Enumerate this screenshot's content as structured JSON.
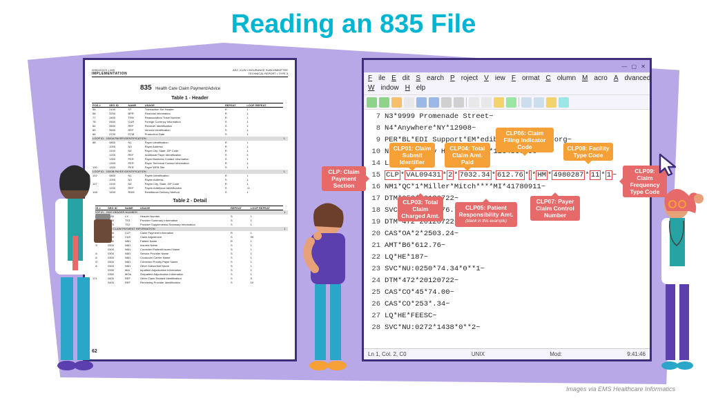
{
  "title": "Reading an 835 File",
  "credit": "Images via EMS Healthcare Informatics",
  "doc_left": {
    "header_small": "005010X221 • 835",
    "header_right1": "ASC X12N • INSURANCE SUBCOMMITTEE",
    "header_right2": "TECHNICAL REPORT • TYPE 3",
    "impl": "IMPLEMENTATION",
    "code": "835",
    "subtitle": "Health Care Claim Payment/Advice",
    "table1_label": "Table 1 - Header",
    "table2_label": "Table 2 - Detail",
    "cols": [
      "POS #",
      "SEG ID",
      "NAME",
      "USAGE",
      "REPEAT",
      "LOOP REPEAT"
    ],
    "t1_rows": [
      [
        "58",
        "0100",
        "ST",
        "Transaction Set Header",
        "R",
        "1",
        ""
      ],
      [
        "58",
        "0200",
        "BPR",
        "Financial Information",
        "R",
        "1",
        ""
      ],
      [
        "77",
        "0400",
        "TRN",
        "Reassociation Trace Number",
        "R",
        "1",
        ""
      ],
      [
        "78",
        "0500",
        "CUR",
        "Foreign Currency Information",
        "S",
        "1",
        ""
      ],
      [
        "84",
        "0600",
        "REF",
        "Receiver Identification",
        "S",
        "1",
        ""
      ],
      [
        "85",
        "0600",
        "REF",
        "Version Identification",
        "S",
        "1",
        ""
      ],
      [
        "86",
        "0700",
        "DTM",
        "Production Date",
        "S",
        "1",
        ""
      ]
    ],
    "t1_loop1": "LOOP ID - 1000A PAYER IDENTIFICATION",
    "t1_rows_b": [
      [
        "88",
        "0800",
        "N1",
        "Payer Identification",
        "R",
        "1",
        ""
      ],
      [
        "",
        "1000",
        "N3",
        "Payer Address",
        "R",
        "1",
        ""
      ],
      [
        "",
        "1100",
        "N4",
        "Payer City, State, ZIP Code",
        "R",
        "1",
        ""
      ],
      [
        "",
        "1200",
        "REF",
        "Additional Payer Identification",
        "S",
        "4",
        ""
      ],
      [
        "",
        "1300",
        "PER",
        "Payer Business Contact Information",
        "S",
        "1",
        ""
      ],
      [
        "",
        "1300",
        "PER",
        "Payer Technical Contact Information",
        "R",
        "1",
        ""
      ],
      [
        "100",
        "1300",
        "PER",
        "Payer WEB Site",
        "S",
        "1",
        ""
      ]
    ],
    "t1_loop2": "LOOP ID - 1000B PAYEE IDENTIFICATION",
    "t1_rows_c": [
      [
        "102",
        "0800",
        "N1",
        "Payee Identification",
        "R",
        "1",
        ""
      ],
      [
        "",
        "1000",
        "N3",
        "Payee Address",
        "S",
        "1",
        ""
      ],
      [
        "107",
        "1100",
        "N4",
        "Payee City, State, ZIP Code",
        "R",
        "1",
        ""
      ],
      [
        "",
        "1200",
        "REF",
        "Payee Additional Identification",
        "S",
        ">1",
        ""
      ],
      [
        "108",
        "1400",
        "RDM",
        "Remittance Delivery Method",
        "S",
        "1",
        ""
      ]
    ],
    "t2_loop1": "LOOP ID - 2000 HEADER NUMBER",
    "t2_rows_a": [
      [
        "111",
        "0030",
        "LX",
        "Header Number",
        "S",
        "1",
        ""
      ],
      [
        "",
        "0050",
        "TS3",
        "Provider Summary Information",
        "S",
        "1",
        ""
      ],
      [
        "117",
        "0070",
        "TS2",
        "Provider Supplemental Summary Information",
        "S",
        "1",
        ""
      ]
    ],
    "t2_loop2": "LOOP ID - 2100 CLAIM PAYMENT INFORMATION",
    "t2_rows_b": [
      [
        "123",
        "0100",
        "CLP",
        "Claim Payment Information",
        "R",
        "1",
        ""
      ],
      [
        "129",
        "0200",
        "CAS",
        "Claim Adjustment",
        "S",
        "99",
        ""
      ],
      [
        "140",
        "0300",
        "NM1",
        "Patient Name",
        "R",
        "1",
        ""
      ],
      [
        "145",
        "0300",
        "NM1",
        "Insured Name",
        "S",
        "1",
        ""
      ],
      [
        "",
        "0300",
        "NM1",
        "Corrected Patient/Insured Name",
        "S",
        "1",
        ""
      ],
      [
        "155",
        "0300",
        "NM1",
        "Service Provider Name",
        "S",
        "1",
        ""
      ],
      [
        "156",
        "0300",
        "NM1",
        "Crossover Carrier Name",
        "S",
        "1",
        ""
      ],
      [
        "160",
        "0300",
        "NM1",
        "Corrected Priority Payer Name",
        "S",
        "1",
        ""
      ],
      [
        "166",
        "0300",
        "NM1",
        "Other Subscriber Name",
        "S",
        "1",
        ""
      ],
      [
        "",
        "0330",
        "MIA",
        "Inpatient Adjudication Information",
        "S",
        "1",
        ""
      ],
      [
        "",
        "0350",
        "MOA",
        "Outpatient Adjudication Information",
        "S",
        "1",
        ""
      ],
      [
        "171",
        "0400",
        "REF",
        "Other Claim Related Identification",
        "S",
        "5",
        ""
      ],
      [
        "",
        "0400",
        "REF",
        "Rendering Provider Identification",
        "S",
        "10",
        ""
      ]
    ],
    "page": "62"
  },
  "editor": {
    "titlebar": "",
    "menu": [
      "File",
      "Edit",
      "Search",
      "Project",
      "View",
      "Format",
      "Column",
      "Macro",
      "Advanced",
      "Window",
      "Help"
    ],
    "lines": [
      {
        "n": 7,
        "t": "N3*9999 Promenade Street~"
      },
      {
        "n": 8,
        "t": "N4*Anywhere*NY*12908~"
      },
      {
        "n": 9,
        "t": "PER*BL*EDI Support*EM*ediblah@blahblah.org~"
      },
      {
        "n": 10,
        "t": "N1*PE*County Hospital*XX*1234567890~"
      },
      {
        "n": 14,
        "t": "LX*1~"
      },
      {
        "n": 15,
        "seg": [
          "CLP",
          "VAL09431",
          "2",
          "7032.34",
          "612.76",
          "",
          "HM",
          "4980287",
          "11",
          "1"
        ]
      },
      {
        "n": 16,
        "t": "NM1*QC*1*Miller*Mitch****MI*41780911~"
      },
      {
        "n": 17,
        "t": "DTM*050*20120722~"
      },
      {
        "n": 18,
        "t": "SVC*HC:99213*76.76*76.76**2~"
      },
      {
        "n": 19,
        "t": "DTM*472*20120722~"
      },
      {
        "n": 20,
        "t": "CAS*OA*2*2503.24~"
      },
      {
        "n": 21,
        "t": "AMT*B6*612.76~"
      },
      {
        "n": 22,
        "t": "LQ*HE*187~"
      },
      {
        "n": 23,
        "t": "SVC*NU:0250*74.34*0**1~"
      },
      {
        "n": 24,
        "t": "DTM*472*20120722~"
      },
      {
        "n": 25,
        "t": "CAS*CO*45*74.00~"
      },
      {
        "n": 26,
        "t": "CAS*CO*253*.34~"
      },
      {
        "n": 27,
        "t": "LQ*HE*FEESC~"
      },
      {
        "n": 28,
        "t": "SVC*NU:0272*1438*0**2~"
      }
    ],
    "status": {
      "pos": "Ln 1, Col. 2, C0",
      "type": "UNIX",
      "mod": "Mod:",
      "time": "9:41:46"
    }
  },
  "callouts": {
    "clp": "CLP: Claim Payment Section",
    "c01": "CLP01: Claim Submit Identifier",
    "c03": "CLP03: Total Claim Charged Amt.",
    "c04": "CLP04: Total Claim Amt. Paid",
    "c05": "CLP05: Patient Responsibility Amt.",
    "c05s": "(blank in this example)",
    "c06": "CLP06: Claim Filing Indicator Code",
    "c07": "CLP07: Payer Claim Control Number",
    "c08": "CLP08: Facility Type Code",
    "c09": "CLP09: Claim Frequency Type Code"
  }
}
